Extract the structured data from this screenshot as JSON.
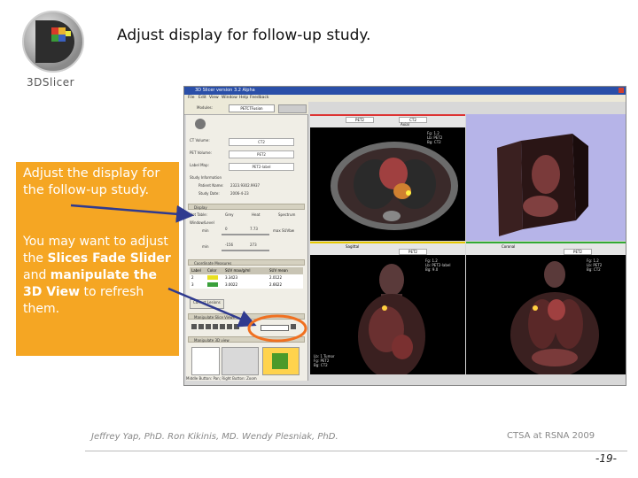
{
  "logo": {
    "text": "3DSlicer"
  },
  "slide": {
    "title": "Adjust display for follow-up study."
  },
  "callout": {
    "line1": "Adjust the display for the follow-up study.",
    "line2_a": "You may want to adjust the ",
    "line2_b": "Slices Fade Slider",
    "line2_c": " and ",
    "line2_d": "manipulate the 3D View",
    "line2_e": " to refresh them."
  },
  "app": {
    "window_title": "3D Slicer version 3.2 Alpha",
    "menu": [
      "File",
      "Edit",
      "View",
      "Window",
      "Help",
      "Feedback"
    ],
    "module_label": "Modules:",
    "module_value": "PETCTFusion",
    "panel": {
      "ct_volume_label": "CT Volume:",
      "ct_volume_value": "CT2",
      "pet_volume_label": "PET Volume:",
      "pet_volume_value": "PET2",
      "label_map_label": "Label Map:",
      "label_map_value": "PET2-label",
      "study_info": "Study Information",
      "patient_name": "Patient Name:",
      "patient_value": "2323.9302.9937",
      "study_date": "Study Date:",
      "study_date_value": "2006-4-23",
      "display_sec": "Display",
      "color_label": "Hot Table:",
      "color_opts": [
        "Grey",
        "Heat",
        "Spectrum"
      ],
      "window_level": "Window/Level",
      "tc_min": "min",
      "tc_max": "max SUVbw",
      "val_a": "0",
      "val_b": "7.73",
      "val_c": "-156",
      "val_d": "273",
      "coord_sec": "Coordinate Measures",
      "table_headers": [
        "Label",
        "Color",
        "SUV max/g/ml",
        "SUV mean"
      ],
      "table_rows": [
        [
          "2",
          "",
          "3.3423",
          "2.0122"
        ],
        [
          "3",
          "",
          "3.0022",
          "2.6622"
        ]
      ],
      "correct_lesions": "Correct Lesions",
      "manip_slice": "Manipulate Slice Views",
      "manip_3d": "Manipulate 3D view"
    },
    "viewers": {
      "red_hdr": "Axial",
      "red_fg": "PET2",
      "red_bg": "CT2",
      "yellow_hdr": "Sagittal",
      "yellow_fg": "PET2",
      "green_hdr": "Coronal",
      "green_fg": "PET2",
      "red_overlay": [
        "Fg: 1.2",
        "Lb: PET2",
        "Bg: CT2"
      ],
      "yellow_overlay": [
        "Fg: 1.2",
        "Lb: PET2-label",
        "Bg: 9.0"
      ],
      "yellow_bottom": [
        "Lb: 1 Tumor",
        "Fg: PET2",
        "Bg: CT2"
      ],
      "green_overlay": [
        "Fg: 1.2",
        "Lb: PET2",
        "Bg: CT2"
      ]
    },
    "status": "Middle Button: Pan; Right Button: Zoom"
  },
  "footer": {
    "names": "Jeffrey Yap, PhD.   Ron Kikinis, MD.   Wendy Plesniak, PhD.",
    "conference": "CTSA at RSNA 2009",
    "page": "-19-"
  },
  "colors": {
    "callout": "#f5a623",
    "arrow": "#2f3a8f",
    "highlight_circle": "#f07020",
    "title_bar": "#2a4fa8",
    "viewer_3d_bg": "#b6b4e8"
  }
}
